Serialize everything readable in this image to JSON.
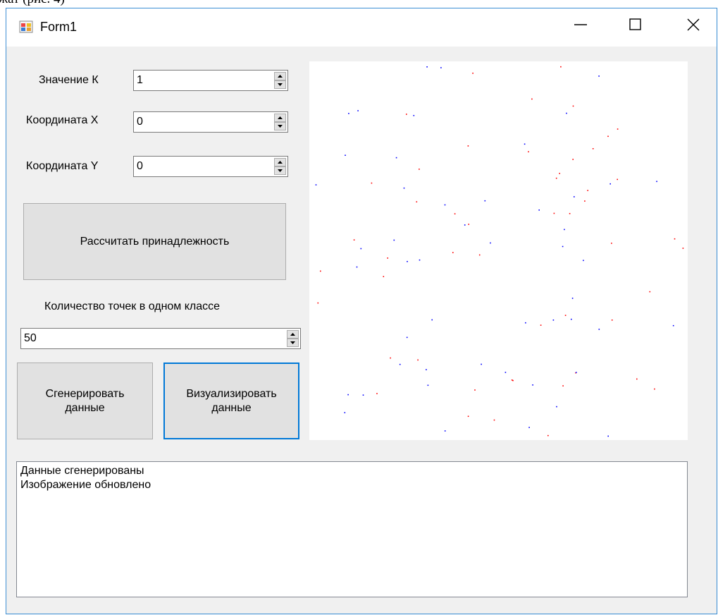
{
  "above_text": "жат (рис. 4)",
  "window": {
    "title": "Form1"
  },
  "form": {
    "k": {
      "label": "Значение К",
      "value": "1"
    },
    "x": {
      "label": "Координата X",
      "value": "0"
    },
    "y": {
      "label": "Координата Y",
      "value": "0"
    },
    "calc_button": "Рассчитать принадлежность",
    "count_label": "Количество точек в одном классе",
    "count_value": "50",
    "generate_button": "Сгенерировать\nданные",
    "visualize_button": "Визуализировать\nданные"
  },
  "log": {
    "lines": [
      "Данные сгенерированы",
      "Изображение обновлено"
    ]
  },
  "colors": {
    "class_a": "#ff0000",
    "class_b": "#0000ff"
  },
  "icons": {
    "app": "form-app-icon",
    "minimize": "minimize-icon",
    "maximize": "maximize-icon",
    "close": "close-icon"
  }
}
